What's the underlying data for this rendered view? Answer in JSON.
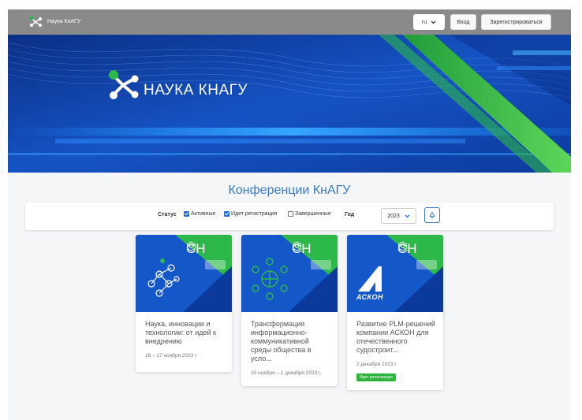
{
  "header": {
    "brand": "Наука КнАГУ",
    "lang": "ru",
    "login": "Вход",
    "register": "Зарегистрироваться"
  },
  "banner": {
    "title": "НАУКА КНАГУ"
  },
  "page_title": "Конференции КнАГУ",
  "filters": {
    "status_label": "Статус",
    "active": {
      "label": "Активные",
      "checked": true
    },
    "registration": {
      "label": "Идет регистрация",
      "checked": true
    },
    "completed": {
      "label": "Завершенные",
      "checked": false
    },
    "year_label": "Год",
    "year_value": "2023"
  },
  "cards": [
    {
      "sno": "СН",
      "title": "Наука, инновации и технологии: от идей к внедрению",
      "date": "16 – 17 ноября 2023 г.",
      "badge": ""
    },
    {
      "sno": "СН",
      "title": "Трансформация информационно-коммуникативной среды общества в усло...",
      "date": "30 ноября – 1 декабря 2023 г.",
      "badge": ""
    },
    {
      "sno": "СН",
      "title": "Развитие PLM-решений компании АСКОН для отечественного судостроит...",
      "date": "2 декабря 2023 г.",
      "badge": "Идет регистрация",
      "logo_text": "АСКОН"
    }
  ],
  "colors": {
    "accent": "#3c7bc4",
    "topbar": "#8a8a8a",
    "banner_blue": "#1457c8",
    "banner_green": "#2db84a",
    "badge_green": "#2bb33a"
  },
  "icons": {
    "brand": "molecule-logo-icon",
    "lang_caret": "chevron-down-icon",
    "year_caret": "chevron-down-icon",
    "reset": "recycle-icon"
  }
}
